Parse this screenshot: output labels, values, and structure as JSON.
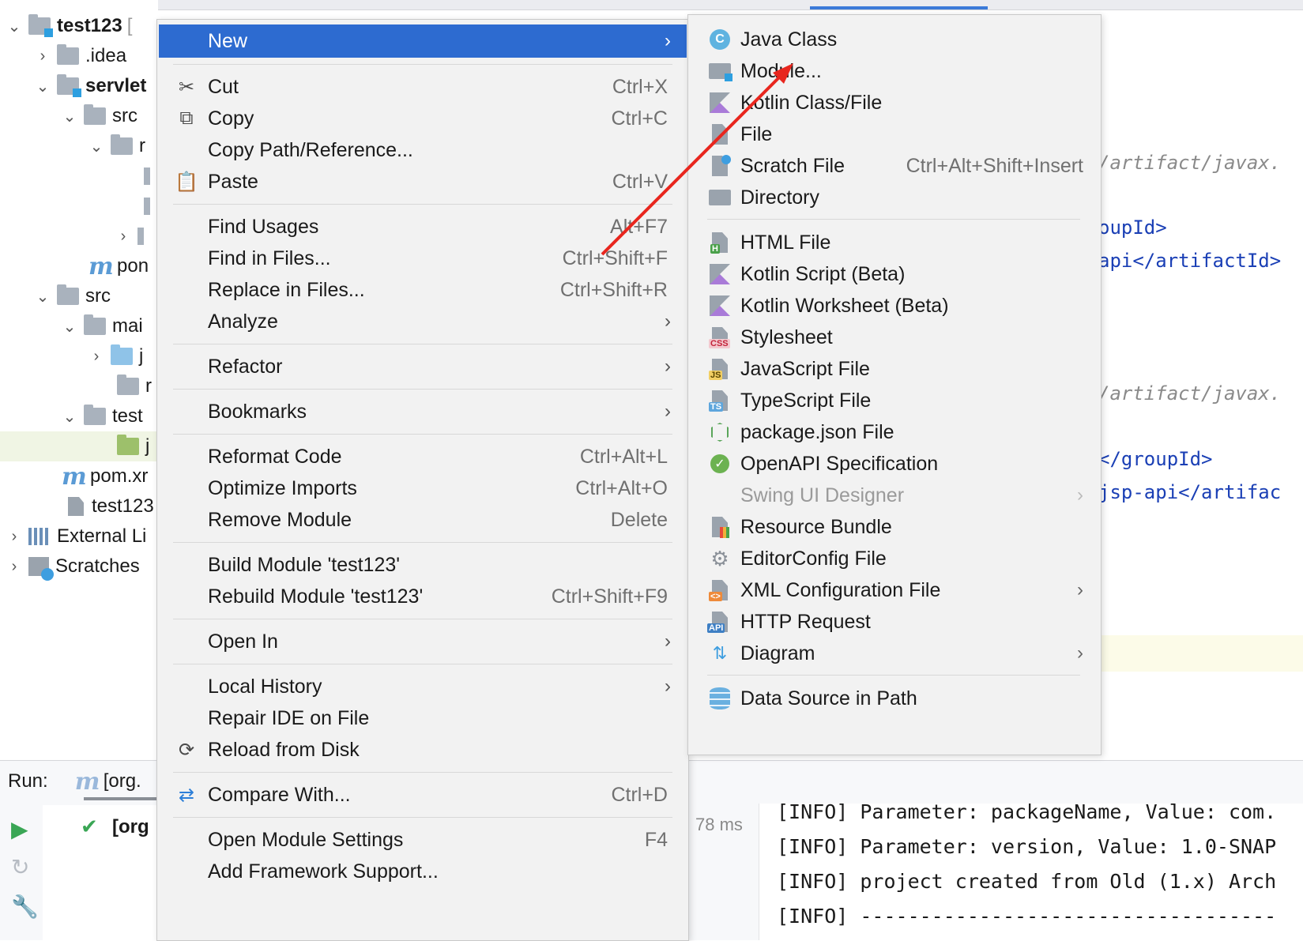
{
  "project_tree": {
    "rows": [
      {
        "label": "test123",
        "suffix": "[",
        "bold": true
      },
      {
        "label": ".idea"
      },
      {
        "label": "servlet",
        "bold": true
      },
      {
        "label": "src"
      },
      {
        "label": "r"
      },
      {
        "label": ""
      },
      {
        "label": ""
      },
      {
        "label": ""
      },
      {
        "label": "pon"
      },
      {
        "label": "src"
      },
      {
        "label": "mai"
      },
      {
        "label": "j"
      },
      {
        "label": "r"
      },
      {
        "label": "test"
      },
      {
        "label": "j"
      },
      {
        "label": "pom.xr"
      },
      {
        "label": "test123"
      },
      {
        "label": "External Li"
      },
      {
        "label": "Scratches"
      }
    ]
  },
  "context_menu": {
    "items": [
      {
        "label": "New",
        "shortcut": "",
        "submenu": true
      },
      {
        "label": "Cut",
        "shortcut": "Ctrl+X",
        "icon": "scissors-icon"
      },
      {
        "label": "Copy",
        "shortcut": "Ctrl+C",
        "icon": "copy-icon"
      },
      {
        "label": "Copy Path/Reference...",
        "shortcut": ""
      },
      {
        "label": "Paste",
        "shortcut": "Ctrl+V",
        "icon": "paste-icon"
      },
      {
        "label": "Find Usages",
        "shortcut": "Alt+F7"
      },
      {
        "label": "Find in Files...",
        "shortcut": "Ctrl+Shift+F"
      },
      {
        "label": "Replace in Files...",
        "shortcut": "Ctrl+Shift+R"
      },
      {
        "label": "Analyze",
        "shortcut": "",
        "submenu": true
      },
      {
        "label": "Refactor",
        "shortcut": "",
        "submenu": true
      },
      {
        "label": "Bookmarks",
        "shortcut": "",
        "submenu": true
      },
      {
        "label": "Reformat Code",
        "shortcut": "Ctrl+Alt+L"
      },
      {
        "label": "Optimize Imports",
        "shortcut": "Ctrl+Alt+O"
      },
      {
        "label": "Remove Module",
        "shortcut": "Delete"
      },
      {
        "label": "Build Module 'test123'",
        "shortcut": ""
      },
      {
        "label": "Rebuild Module 'test123'",
        "shortcut": "Ctrl+Shift+F9"
      },
      {
        "label": "Open In",
        "shortcut": "",
        "submenu": true
      },
      {
        "label": "Local History",
        "shortcut": "",
        "submenu": true
      },
      {
        "label": "Repair IDE on File",
        "shortcut": ""
      },
      {
        "label": "Reload from Disk",
        "shortcut": "",
        "icon": "reload-icon"
      },
      {
        "label": "Compare With...",
        "shortcut": "Ctrl+D",
        "icon": "compare-icon"
      },
      {
        "label": "Open Module Settings",
        "shortcut": "F4"
      },
      {
        "label": "Add Framework Support...",
        "shortcut": ""
      }
    ]
  },
  "new_submenu": {
    "items": [
      {
        "label": "Java Class",
        "shortcut": ""
      },
      {
        "label": "Module...",
        "shortcut": ""
      },
      {
        "label": "Kotlin Class/File",
        "shortcut": ""
      },
      {
        "label": "File",
        "shortcut": ""
      },
      {
        "label": "Scratch File",
        "shortcut": "Ctrl+Alt+Shift+Insert"
      },
      {
        "label": "Directory",
        "shortcut": ""
      },
      {
        "label": "HTML File",
        "shortcut": ""
      },
      {
        "label": "Kotlin Script (Beta)",
        "shortcut": ""
      },
      {
        "label": "Kotlin Worksheet (Beta)",
        "shortcut": ""
      },
      {
        "label": "Stylesheet",
        "shortcut": ""
      },
      {
        "label": "JavaScript File",
        "shortcut": ""
      },
      {
        "label": "TypeScript File",
        "shortcut": ""
      },
      {
        "label": "package.json File",
        "shortcut": ""
      },
      {
        "label": "OpenAPI Specification",
        "shortcut": ""
      },
      {
        "label": "Swing UI Designer",
        "shortcut": "",
        "disabled": true
      },
      {
        "label": "Resource Bundle",
        "shortcut": ""
      },
      {
        "label": "EditorConfig File",
        "shortcut": ""
      },
      {
        "label": "XML Configuration File",
        "shortcut": ""
      },
      {
        "label": "HTTP Request",
        "shortcut": ""
      },
      {
        "label": "Diagram",
        "shortcut": ""
      },
      {
        "label": "Data Source in Path",
        "shortcut": ""
      }
    ],
    "badges": {
      "html": "H",
      "css": "CSS",
      "js": "JS",
      "ts": "TS",
      "xml": "<>",
      "api": "API",
      "class": "C"
    }
  },
  "editor": {
    "lines": [
      {
        "text": "/artifact/javax.",
        "kind": "comment"
      },
      {
        "text": "oupId>",
        "kind": "code"
      },
      {
        "text": "api</artifactId>",
        "kind": "code"
      },
      {
        "text": "/artifact/javax.",
        "kind": "comment"
      },
      {
        "text": "</groupId>",
        "kind": "code"
      },
      {
        "text": "jsp-api</artifac",
        "kind": "code"
      }
    ]
  },
  "run_panel": {
    "label": "Run:",
    "tab_label": "[org.",
    "tree_item": "[org",
    "duration": "78 ms",
    "console": [
      "[INFO] Parameter: packageName, Value: com.",
      "[INFO] Parameter: version, Value: 1.0-SNAP",
      "[INFO] project created from Old (1.x) Arch",
      "[INFO] -----------------------------------"
    ]
  },
  "colors": {
    "accent": "#2d6bd0",
    "annotation_arrow": "#e8261e"
  }
}
